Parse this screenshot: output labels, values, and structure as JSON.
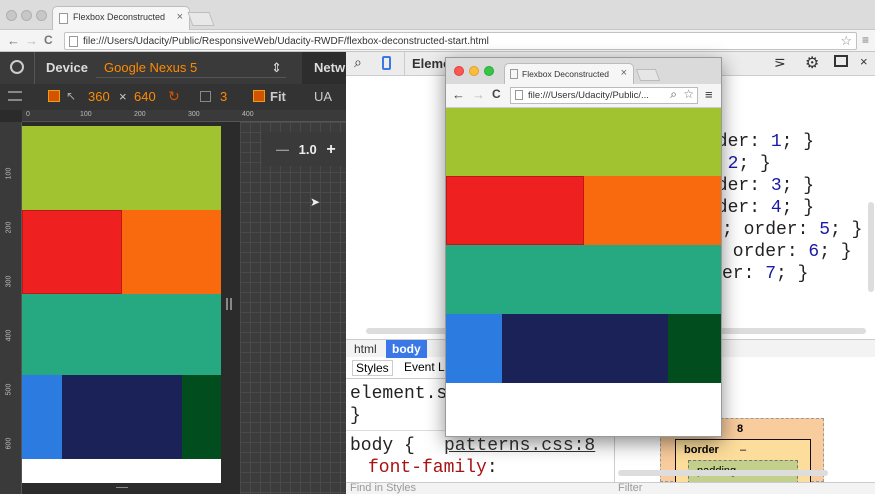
{
  "browser": {
    "tab_title": "Flexbox Deconstructed",
    "close_tab_glyph": "×",
    "url": "file:///Users/Udacity/Public/ResponsiveWeb/Udacity-RWDF/flexbox-deconstructed-start.html",
    "nav_back": "←",
    "nav_forward": "→",
    "nav_reload": "C",
    "star": "☆"
  },
  "emulation": {
    "device_label": "Device",
    "device_value": "Google Nexus 5",
    "width": "360",
    "times": "×",
    "height": "640",
    "scale_value": "3",
    "fit_label": "Fit",
    "ua_label": "UA",
    "netw_label": "Netw",
    "zoom_minus": "—",
    "zoom_value": "1.0",
    "zoom_plus": "+",
    "ruler_h": [
      "0",
      "100",
      "200",
      "300",
      "400"
    ],
    "ruler_v": [
      "100",
      "200",
      "300",
      "400",
      "500",
      "600"
    ]
  },
  "devtools": {
    "elements_tab": "Eleme",
    "code_lines": [
      {
        "pre": "rder",
        "sep": ": ",
        "num": "1",
        "post": "; }"
      },
      {
        "pre": "",
        "sep": ": ",
        "num": "2",
        "post": "; }"
      },
      {
        "pre": "rder",
        "sep": ": ",
        "num": "3",
        "post": "; }"
      },
      {
        "pre": "rder",
        "sep": ": ",
        "num": "4",
        "post": "; }"
      },
      {
        "pre": "; order",
        "sep": ": ",
        "num": "5",
        "post": "; }"
      },
      {
        "pre": " order",
        "sep": ": ",
        "num": "6",
        "post": "; }"
      },
      {
        "pre": "er",
        "sep": ": ",
        "num": "7",
        "post": "; }"
      }
    ],
    "crumb_html": "html",
    "crumb_body": "body",
    "styles_tab": "Styles",
    "event_tab": "Event L",
    "rule1": "element.s",
    "rule1_close": "}",
    "rule2_selector": "body {",
    "rule2_source": "patterns.css:8",
    "rule2_prop": "font-family",
    "rule2_colon": ":",
    "find_placeholder": "Find in Styles",
    "filter_placeholder": "Filter",
    "box_margin": "8",
    "box_border": "border",
    "box_dash": "–",
    "box_padding": "padding –"
  },
  "popup": {
    "tab_title": "Flexbox Deconstructed",
    "close_glyph": "×",
    "url": "file:///Users/Udacity/Public/...",
    "menu_glyph": "≡",
    "search_glyph": "⌕"
  },
  "colors": {
    "green": "#a2c330",
    "red": "#ef2020",
    "orange": "#f9690e",
    "teal": "#26a980",
    "blue": "#2b7be0",
    "navy": "#1a2257",
    "dark_green": "#024d1d"
  }
}
